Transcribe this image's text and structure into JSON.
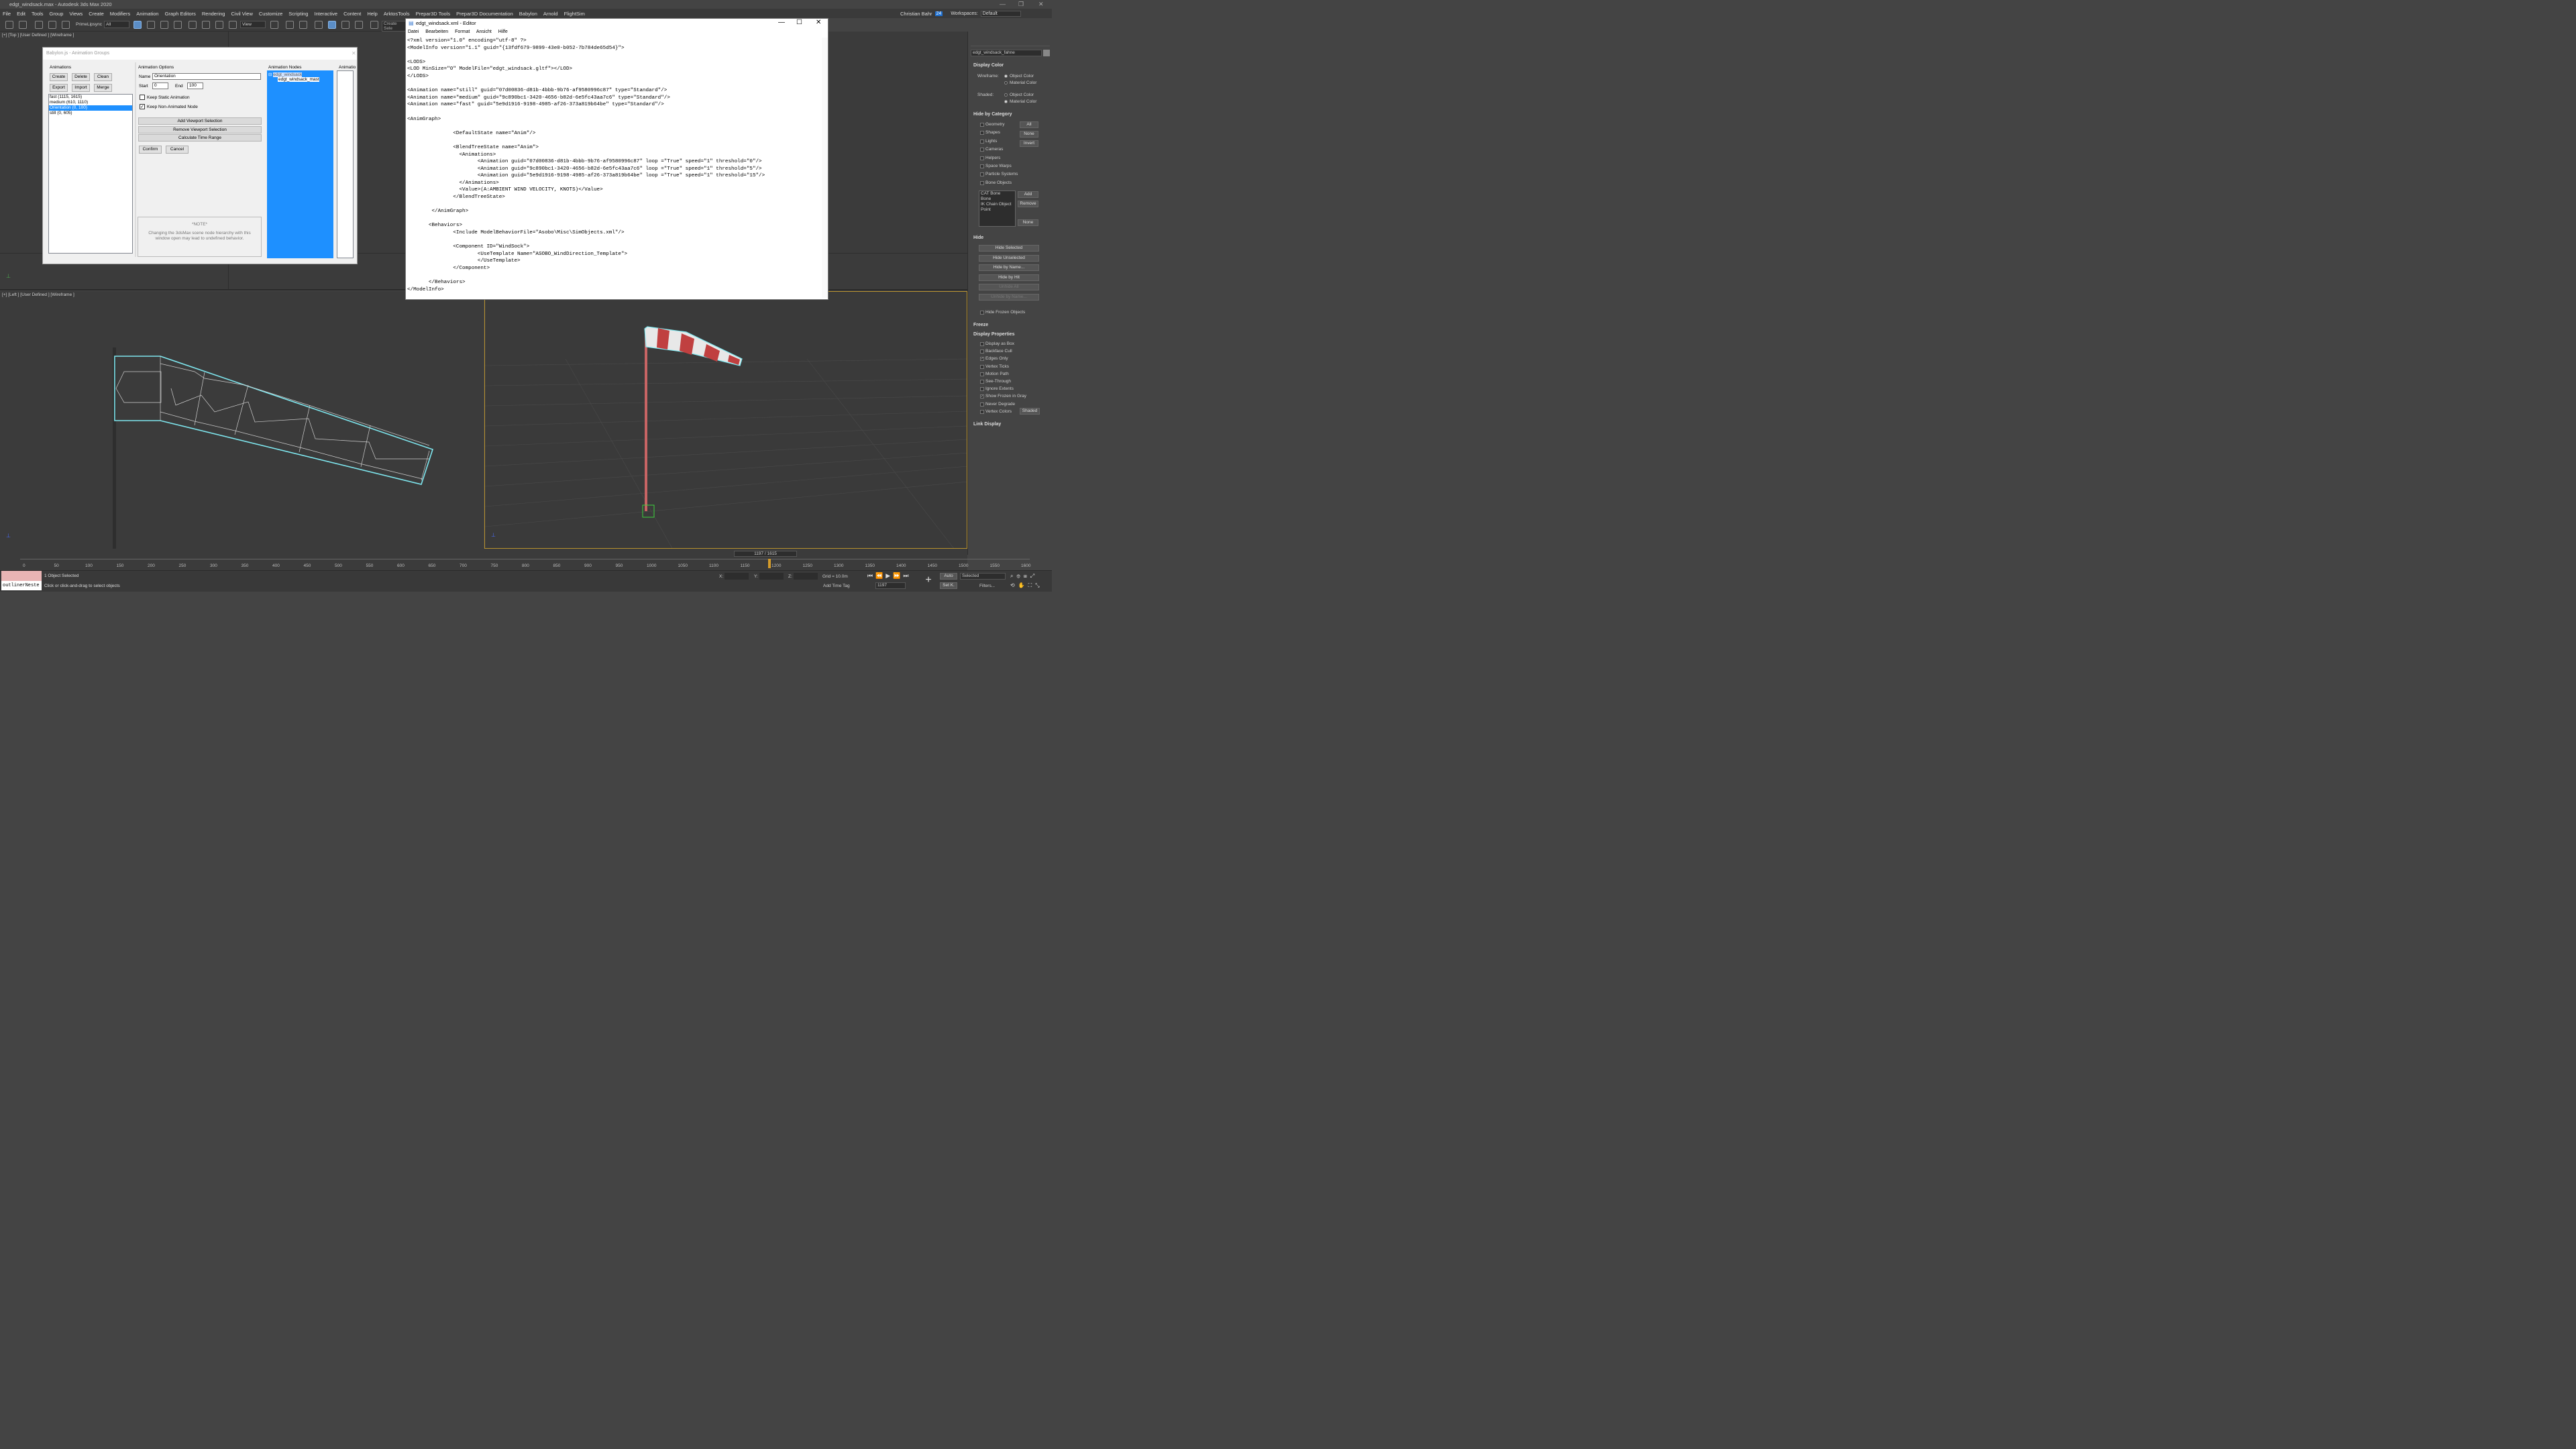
{
  "window": {
    "title": "edgt_windsack.max - Autodesk 3ds Max 2020"
  },
  "menu": [
    "File",
    "Edit",
    "Tools",
    "Group",
    "Views",
    "Create",
    "Modifiers",
    "Animation",
    "Graph Editors",
    "Rendering",
    "Civil View",
    "Customize",
    "Scripting",
    "Interactive",
    "Content",
    "Help",
    "ArktosTools",
    "Prepar3D Tools",
    "Prepar3D Documentation",
    "Babylon",
    "Arnold",
    "FlightSim"
  ],
  "user": {
    "name": "Christian Bahr",
    "badge": "24",
    "workspaces_label": "Workspaces:",
    "workspace": "Default"
  },
  "toolbar": {
    "lipsync": "PrimeLipsync",
    "filter": "All",
    "view": "View",
    "create_sel": "Create Sele"
  },
  "viewports": {
    "top_label": "[+] [Top ] [User Defined ] [Wireframe ]",
    "left_label": "[+] [Left ] [User Defined ] [Wireframe ]"
  },
  "dialog": {
    "title": "Babylon.js - Animation Groups",
    "animations_label": "Animations",
    "create": "Create",
    "delete": "Delete",
    "clean": "Clean",
    "export": "Export",
    "import": "Import",
    "merge": "Merge",
    "groups": [
      "fast (1115, 1615)",
      "medium (610, 1110)",
      "Orientation (0, 100)",
      "still (0, 605)"
    ],
    "options_label": "Animation Options",
    "name_label": "Name",
    "name_value": "Orientation",
    "start_label": "Start",
    "start_value": "0",
    "end_label": "End",
    "end_value": "100",
    "keep_static": "Keep Static Animation",
    "keep_non_animated": "Keep Non-Animated Node",
    "add_viewport": "Add Viewport Selection",
    "remove_viewport": "Remove Viewport Selection",
    "calc_time": "Calculate Time Range",
    "confirm": "Confirm",
    "cancel": "Cancel",
    "note_title": "*NOTE*",
    "note_text": "Changing the 3dsMax scene node hierarchy with this window open may lead to undefined behavior.",
    "nodes_label": "Animation Nodes",
    "node_root": "edgt_windsack",
    "node_child": "edgt_windsack_mast",
    "anim_label": "Animatio"
  },
  "editor": {
    "title": "edgt_windsack.xml - Editor",
    "menu": [
      "Datei",
      "Bearbeiten",
      "Format",
      "Ansicht",
      "Hilfe"
    ],
    "lines": [
      "<?xml version=\"1.0\" encoding=\"utf-8\" ?>",
      "<ModelInfo version=\"1.1\" guid=\"{13fdf679-9899-43e0-b052-7b784de65d54}\">",
      "",
      "<LODS>",
      "<LOD MinSize=\"0\" ModelFile=\"edgt_windsack.gltf\"></LOD>",
      "</LODS>",
      "",
      "<Animation name=\"still\" guid=\"07d00836-d81b-4bbb-9b76-af9580996c87\" type=\"Standard\"/>",
      "<Animation name=\"medium\" guid=\"9c890bc1-3420-4656-b82d-6e5fc43aa7c6\" type=\"Standard\"/>",
      "<Animation name=\"fast\" guid=\"5e9d1916-9198-4985-af26-373a819b64be\" type=\"Standard\"/>",
      "",
      "<AnimGraph>",
      "",
      "               <DefaultState name=\"Anim\"/>",
      "",
      "               <BlendTreeState name=\"Anim\">",
      "                 <Animations>",
      "                       <Animation guid=\"07d00836-d81b-4bbb-9b76-af9580996c87\" loop =\"True\" speed=\"1\" threshold=\"0\"/>",
      "                       <Animation guid=\"9c890bc1-3420-4656-b82d-6e5fc43aa7c6\" loop =\"True\" speed=\"1\" threshold=\"5\"/>",
      "                       <Animation guid=\"5e9d1916-9198-4985-af26-373a819b64be\" loop =\"True\" speed=\"1\" threshold=\"15\"/>",
      "                 </Animations>",
      "                 <Value>(A:AMBIENT WIND VELOCITY, KNOTS)</Value>",
      "               </BlendTreeState>",
      "",
      "        </AnimGraph>",
      "",
      "       <Behaviors>",
      "               <Include ModelBehaviorFile=\"Asobo\\Misc\\SimObjects.xml\"/>",
      "",
      "               <Component ID=\"WindSock\">",
      "                       <UseTemplate Name=\"ASOBO_WindDirection_Template\">",
      "                       </UseTemplate>",
      "               </Component>",
      "",
      "       </Behaviors>",
      "</ModelInfo>"
    ]
  },
  "command_panel": {
    "object_name": "edgt_windsack_fahne",
    "display_color": "Display Color",
    "wireframe_label": "Wireframe:",
    "shaded_label": "Shaded:",
    "object_color": "Object Color",
    "material_color": "Material Color",
    "hide_by_category": "Hide by Category",
    "categories": [
      "Geometry",
      "Shapes",
      "Lights",
      "Cameras",
      "Helpers",
      "Space Warps",
      "Particle Systems",
      "Bone Objects"
    ],
    "all": "All",
    "none": "None",
    "invert": "Invert",
    "bone_list": [
      "CAT Bone",
      "Bone",
      "IK Chain Object",
      "Point"
    ],
    "add": "Add",
    "remove": "Remove",
    "none2": "None",
    "hide": "Hide",
    "hide_buttons": [
      "Hide Selected",
      "Hide Unselected",
      "Hide by Name...",
      "Hide by Hit",
      "Unhide All",
      "Unhide by Name..."
    ],
    "hide_frozen": "Hide Frozen Objects",
    "freeze": "Freeze",
    "display_properties": "Display Properties",
    "props": [
      "Display as Box",
      "Backface Cull",
      "Edges Only",
      "Vertex Ticks",
      "Motion Path",
      "See-Through",
      "Ignore Extents",
      "Show Frozen in Gray",
      "Never Degrade",
      "Vertex Colors"
    ],
    "shaded": "Shaded",
    "link_display": "Link Display"
  },
  "timeline": {
    "frame": "1197 / 1615",
    "ticks": [
      "0",
      "50",
      "100",
      "150",
      "200",
      "250",
      "300",
      "350",
      "400",
      "450",
      "500",
      "550",
      "600",
      "650",
      "700",
      "750",
      "800",
      "850",
      "900",
      "950",
      "1000",
      "1050",
      "1100",
      "1150",
      "1200",
      "1250",
      "1300",
      "1350",
      "1400",
      "1450",
      "1500",
      "1550",
      "1600"
    ]
  },
  "status": {
    "script_field": "outlinerNeste",
    "selected": "1 Object Selected",
    "hint": "Click or click-and-drag to select objects",
    "x_label": "X:",
    "y_label": "Y:",
    "z_label": "Z:",
    "grid": "Grid = 10.0m",
    "add_time_tag": "Add Time Tag",
    "auto": "Auto",
    "selected_dd": "Selected",
    "set_k": "Set K.",
    "filters": "Filters...",
    "frame_field": "1197"
  },
  "colors": {
    "selection_blue": "#1e90ff",
    "wire_cyan": "#7fe8f0",
    "sock_red": "#c04040"
  }
}
